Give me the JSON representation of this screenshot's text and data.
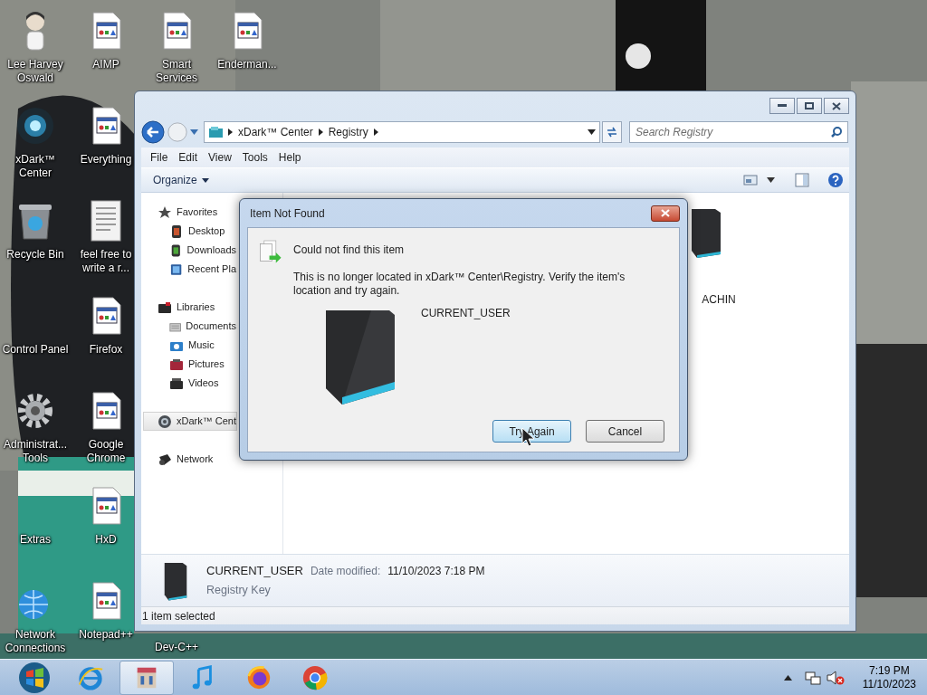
{
  "desktop_icons": [
    {
      "label": "Lee Harvey Oswald",
      "kind": "figure"
    },
    {
      "label": "xDark™ Center",
      "kind": "disc"
    },
    {
      "label": "Recycle Bin",
      "kind": "bin"
    },
    {
      "label": "Control Panel"
    },
    {
      "label": "Administrat... Tools",
      "kind": "gear"
    },
    {
      "label": "Extras"
    },
    {
      "label": "Network Connections",
      "kind": "globe"
    },
    {
      "label": "AIMP",
      "kind": "app"
    },
    {
      "label": "Everything",
      "kind": "app"
    },
    {
      "label": "feel free to write a r...",
      "kind": "text"
    },
    {
      "label": "Firefox",
      "kind": "app"
    },
    {
      "label": "Google Chrome",
      "kind": "app"
    },
    {
      "label": "HxD",
      "kind": "app"
    },
    {
      "label": "Notepad++",
      "kind": "app"
    },
    {
      "label": "Smart Services",
      "kind": "app"
    },
    {
      "label": "Dev-C++"
    },
    {
      "label": "Enderman...",
      "kind": "app"
    }
  ],
  "explorer": {
    "address": [
      "xDark™ Center",
      "Registry"
    ],
    "search": {
      "placeholder": "Search Registry"
    },
    "menu": [
      "File",
      "Edit",
      "View",
      "Tools",
      "Help"
    ],
    "organize": "Organize",
    "nav": [
      {
        "label": "Favorites",
        "kind": "star",
        "selected": false,
        "children": [
          {
            "label": "Desktop",
            "kind": "desktop",
            "selected": false
          },
          {
            "label": "Downloads",
            "kind": "download",
            "selected": false
          },
          {
            "label": "Recent Pla",
            "kind": "recent",
            "selected": false
          }
        ]
      },
      {
        "label": "Libraries",
        "kind": "library",
        "selected": false,
        "children": [
          {
            "label": "Documents",
            "kind": "docs",
            "selected": false
          },
          {
            "label": "Music",
            "kind": "music",
            "selected": false
          },
          {
            "label": "Pictures",
            "kind": "pictures",
            "selected": false
          },
          {
            "label": "Videos",
            "kind": "videos",
            "selected": false
          }
        ]
      },
      {
        "label": "xDark™ Cent",
        "kind": "disc",
        "selected": true
      },
      {
        "label": "Network",
        "kind": "network",
        "selected": false
      }
    ],
    "visible_item": "ACHIN",
    "details": {
      "name": "CURRENT_USER",
      "date_label": "Date modified:",
      "date": "11/10/2023 7:18 PM",
      "type": "Registry Key"
    },
    "status": "1 item selected"
  },
  "dialog": {
    "title": "Item Not Found",
    "heading": "Could not find this item",
    "message": "This is no longer located in xDark™ Center\\Registry. Verify the item's location and try again.",
    "item": "CURRENT_USER",
    "buttons": [
      {
        "label": "Try Again",
        "selected": true
      },
      {
        "label": "Cancel",
        "selected": false
      }
    ]
  },
  "taskbar": {
    "items": [
      {
        "kind": "start",
        "selected": false
      },
      {
        "kind": "ie",
        "selected": false
      },
      {
        "kind": "explorer",
        "selected": true
      },
      {
        "kind": "music",
        "selected": false
      },
      {
        "kind": "firefox",
        "selected": false
      },
      {
        "kind": "chrome",
        "selected": false
      }
    ],
    "time": "7:19 PM",
    "date": "11/10/2023"
  }
}
